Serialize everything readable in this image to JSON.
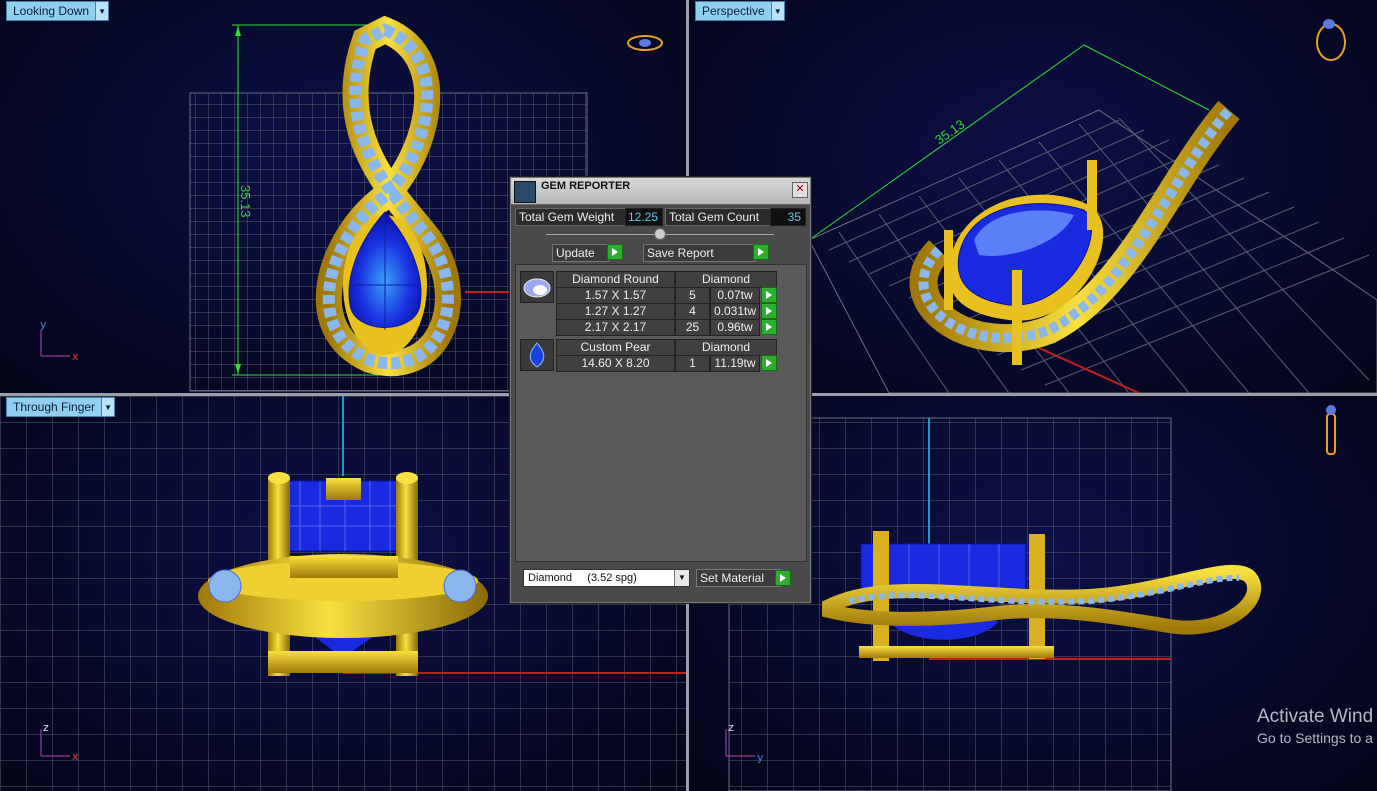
{
  "viewports": {
    "top_left": {
      "label": "Looking Down",
      "dimension": "35.13",
      "axis_v": "y",
      "axis_h": "x"
    },
    "top_right": {
      "label": "Perspective",
      "dimension": "35.13"
    },
    "bottom_left": {
      "label": "Through Finger",
      "axis_v": "z",
      "axis_h": "x"
    },
    "bottom_right": {
      "axis_v": "z",
      "axis_h": "y"
    }
  },
  "gem_reporter": {
    "title": "GEM REPORTER",
    "close": "✕",
    "total_weight_label": "Total Gem Weight",
    "total_weight_value": "12.25",
    "total_count_label": "Total Gem Count",
    "total_count_value": "35",
    "update_label": "Update",
    "save_report_label": "Save Report",
    "groups": [
      {
        "name": "Diamond Round",
        "material": "Diamond",
        "rows": [
          {
            "size": "1.57 X 1.57",
            "count": "5",
            "weight": "0.07tw"
          },
          {
            "size": "1.27 X 1.27",
            "count": "4",
            "weight": "0.031tw"
          },
          {
            "size": "2.17 X 2.17",
            "count": "25",
            "weight": "0.96tw"
          }
        ]
      },
      {
        "name": "Custom Pear",
        "material": "Diamond",
        "rows": [
          {
            "size": "14.60 X 8.20",
            "count": "1",
            "weight": "11.19tw"
          }
        ]
      }
    ],
    "material_select": "Diamond     (3.52 spg)",
    "set_material_label": "Set Material"
  },
  "watermark": {
    "line1": "Activate Wind",
    "line2": "Go to Settings to a"
  },
  "colors": {
    "gold": "#e8c020",
    "gem_blue": "#1a2ae0",
    "stone_light": "#6aaaf0",
    "grid": "#5a5e6e",
    "dimension": "#33dd33",
    "x_axis": "#c02020",
    "z_axis": "#1a9ad0"
  }
}
